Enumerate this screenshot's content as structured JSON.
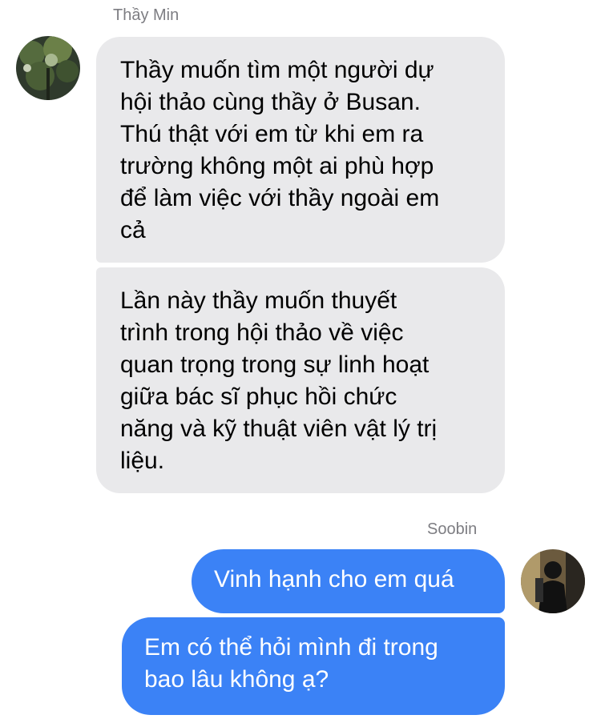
{
  "conversation": {
    "incoming_sender": "Thầy Min",
    "outgoing_sender": "Soobin",
    "incoming_messages": [
      "Thầy muốn tìm một người dự\nhội thảo cùng thầy ở Busan.\nThú thật với em từ khi em ra\ntrường không một ai phù hợp\nđể làm việc với thầy ngoài em\ncả",
      "Lần này thầy muốn thuyết\ntrình trong hội thảo về việc\nquan trọng trong sự linh hoạt\ngiữa bác sĩ phục hồi chức\nnăng và kỹ thuật viên vật lý trị\nliệu."
    ],
    "outgoing_messages": [
      "Vinh hạnh cho em quá",
      "Em có thể hỏi mình đi trong\nbao lâu không ạ?"
    ]
  },
  "colors": {
    "incoming_bubble": "#e9e9eb",
    "outgoing_bubble": "#3b82f6",
    "sender_name": "#7d7d82"
  },
  "icons": {
    "incoming_avatar": "tree-photo-avatar",
    "outgoing_avatar": "person-photo-avatar"
  }
}
